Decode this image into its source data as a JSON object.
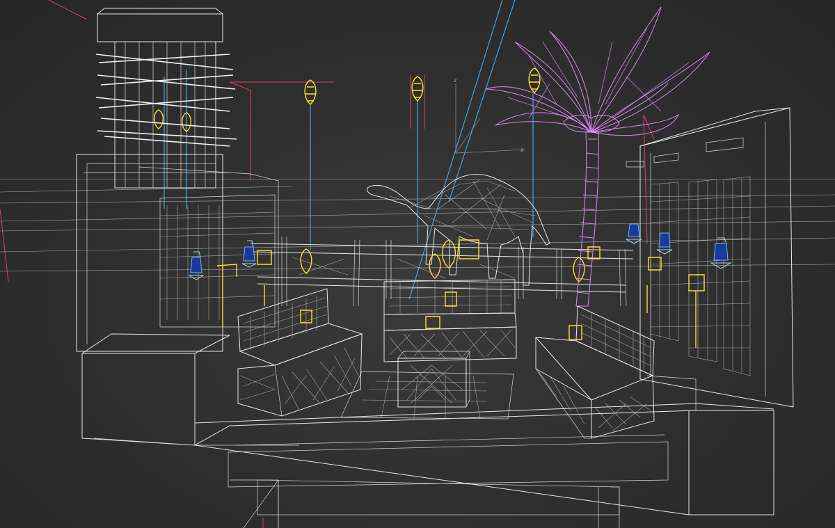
{
  "viewport": {
    "mode": "wireframe",
    "colors": {
      "background": "#2f2f2f",
      "geometry": "#e8e8e8",
      "light_cable": "#4aa3e0",
      "light_fixture": "#ffe030",
      "palm_tree": "#d98af0",
      "selection": "#e04060",
      "lantern_body": "#1a3a9a"
    }
  },
  "scene_objects": [
    {
      "name": "camel",
      "icon": "camel-wireframe"
    },
    {
      "name": "palm-tree",
      "icon": "palm-tree-wireframe"
    },
    {
      "name": "lattice-tower",
      "icon": "lattice-tower-wireframe"
    },
    {
      "name": "sofa-left",
      "icon": "sofa-wireframe"
    },
    {
      "name": "sofa-center",
      "icon": "sofa-wireframe"
    },
    {
      "name": "sofa-right",
      "icon": "sofa-wireframe"
    },
    {
      "name": "coffee-table",
      "icon": "table-wireframe"
    },
    {
      "name": "fence",
      "icon": "fence-wireframe"
    },
    {
      "name": "screen-panel-right",
      "icon": "screen-panel-wireframe"
    },
    {
      "name": "platform",
      "icon": "platform-wireframe"
    },
    {
      "name": "pendant-lamps",
      "icon": "pendant-lamp-wireframe"
    },
    {
      "name": "lanterns",
      "icon": "lantern-wireframe"
    }
  ]
}
